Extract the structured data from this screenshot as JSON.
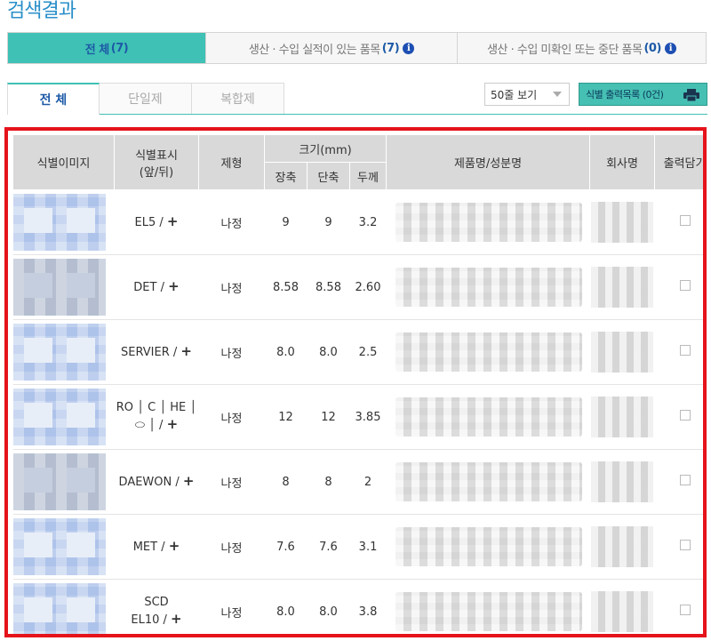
{
  "page_title": "검색결과",
  "top_tabs": [
    {
      "label": "전 체",
      "count": "(7)"
    },
    {
      "label": "생산 · 수입 실적이 있는 품목",
      "count": "(7)"
    },
    {
      "label": "생산 · 수입 미확인 또는 중단 품목",
      "count": "(0)"
    }
  ],
  "sub_tabs": [
    "전 체",
    "단일제",
    "복합제"
  ],
  "select": {
    "value": "50줄 보기"
  },
  "print_button": {
    "label": "식별 출력목록 (0건)"
  },
  "table": {
    "headers": {
      "image": "식별이미지",
      "mark_line1": "식별표시",
      "mark_line2": "(앞/뒤)",
      "form": "제형",
      "size": "크기(mm)",
      "long": "장축",
      "short": "단축",
      "thick": "두께",
      "product": "제품명/성분명",
      "company": "회사명",
      "print": "출력담기"
    },
    "rows": [
      {
        "mark1": "EL5 /",
        "mark2": "",
        "form": "나정",
        "long": "9",
        "short": "9",
        "thick": "3.2",
        "img": "blue"
      },
      {
        "mark1": "DET /",
        "mark2": "",
        "form": "나정",
        "long": "8.58",
        "short": "8.58",
        "thick": "2.60",
        "img": "gray"
      },
      {
        "mark1": "SERVIER /",
        "mark2": "",
        "form": "나정",
        "long": "8.0",
        "short": "8.0",
        "thick": "2.5",
        "img": "blue"
      },
      {
        "mark1": "RO │ C │ HE │",
        "mark2": "⬭ │ /",
        "form": "나정",
        "long": "12",
        "short": "12",
        "thick": "3.85",
        "img": "blue"
      },
      {
        "mark1": "DAEWON /",
        "mark2": "",
        "form": "나정",
        "long": "8",
        "short": "8",
        "thick": "2",
        "img": "gray"
      },
      {
        "mark1": "MET /",
        "mark2": "",
        "form": "나정",
        "long": "7.6",
        "short": "7.6",
        "thick": "3.1",
        "img": "blue"
      },
      {
        "mark1": "SCD",
        "mark2": "EL10 /",
        "form": "나정",
        "long": "8.0",
        "short": "8.0",
        "thick": "3.8",
        "img": "blue"
      }
    ]
  },
  "icons": {
    "info": "info-icon",
    "print": "printer-icon",
    "caret": "chevron-down-icon"
  },
  "colors": {
    "accent": "#3fc1b5",
    "title": "#2a8fc9",
    "highlight_border": "#e5131b"
  }
}
